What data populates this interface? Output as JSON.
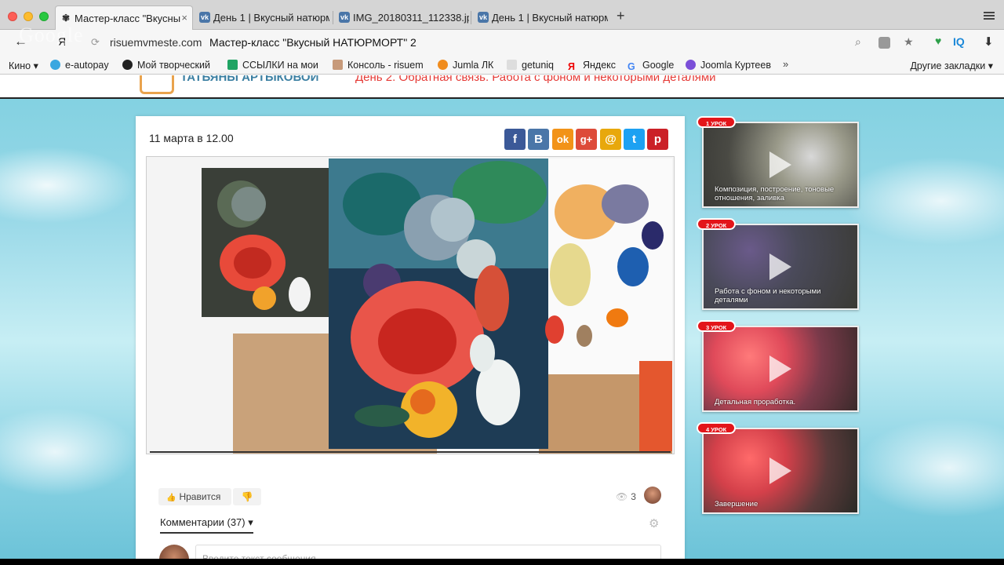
{
  "tabs": [
    {
      "label": "Мастер-класс \"Вкусны",
      "icon": "paint-icon",
      "active": true
    },
    {
      "label": "День 1 | Вкусный натюрм",
      "icon": "vk-icon",
      "active": false
    },
    {
      "label": "IMG_20180311_112338.jp",
      "icon": "vk-icon",
      "active": false
    },
    {
      "label": "День 1 | Вкусный натюрм",
      "icon": "vk-icon",
      "active": false
    }
  ],
  "new_tab_label": "+",
  "close_label": "×",
  "toolbar": {
    "back": "←",
    "ghost_logo": "Google",
    "ya": "Я",
    "reload": "⟳",
    "domain": "risuemvmeste.com",
    "page_title": "Мастер-класс \"Вкусный НАТЮРМОРТ\" 2",
    "search_glyph": "⌕",
    "star_glyph": "★",
    "iq": "IQ",
    "download_glyph": "⬇",
    "ext_glyph": "♥"
  },
  "bookmarks": [
    {
      "label": "Кино ▾"
    },
    {
      "label": "e-autopay"
    },
    {
      "label": "Мой творческий"
    },
    {
      "label": "ССЫЛКИ на мои"
    },
    {
      "label": "Консоль - risuem"
    },
    {
      "label": "Jumla ЛК"
    },
    {
      "label": "getuniq"
    },
    {
      "label": "Яндекс"
    },
    {
      "label": "Google"
    },
    {
      "label": "Joomla Куртеев"
    }
  ],
  "bookmarks_more": "»",
  "bookmarks_other": "Другие закладки ▾",
  "site": {
    "logo_text": "ТАТЬЯНЫ АРТЫКОВОЙ",
    "day_title": "День 2. Обратная связь. Работа с фоном и некоторыми деталями"
  },
  "post": {
    "date": "11 марта в 12.00",
    "share": [
      {
        "name": "facebook",
        "glyph": "f",
        "color": "#3b5998"
      },
      {
        "name": "vkontakte",
        "glyph": "В",
        "color": "#4a76a8"
      },
      {
        "name": "odnoklassniki",
        "glyph": "ok",
        "color": "#f29318"
      },
      {
        "name": "google-plus",
        "glyph": "g+",
        "color": "#dd4b39"
      },
      {
        "name": "mail",
        "glyph": "@",
        "color": "#e8a80c"
      },
      {
        "name": "twitter",
        "glyph": "t",
        "color": "#1da1f2"
      },
      {
        "name": "pinterest",
        "glyph": "p",
        "color": "#cb2027"
      }
    ],
    "like_label": "Нравится",
    "like_glyph": "👍",
    "dislike_glyph": "👎",
    "views_glyph": "👁",
    "views": "3",
    "comments_label": "Комментарии (37) ▾",
    "settings_glyph": "⚙",
    "comment_placeholder": "Введите текст сообщения"
  },
  "lessons": [
    {
      "badge": "1 УРОК",
      "caption": "Композиция, построение, тоновые отношения, заливка"
    },
    {
      "badge": "2 УРОК",
      "caption": "Работа с фоном и некоторыми деталями"
    },
    {
      "badge": "3 УРОК",
      "caption": "Детальная проработка."
    },
    {
      "badge": "4 УРОК",
      "caption": "Завершение"
    }
  ]
}
